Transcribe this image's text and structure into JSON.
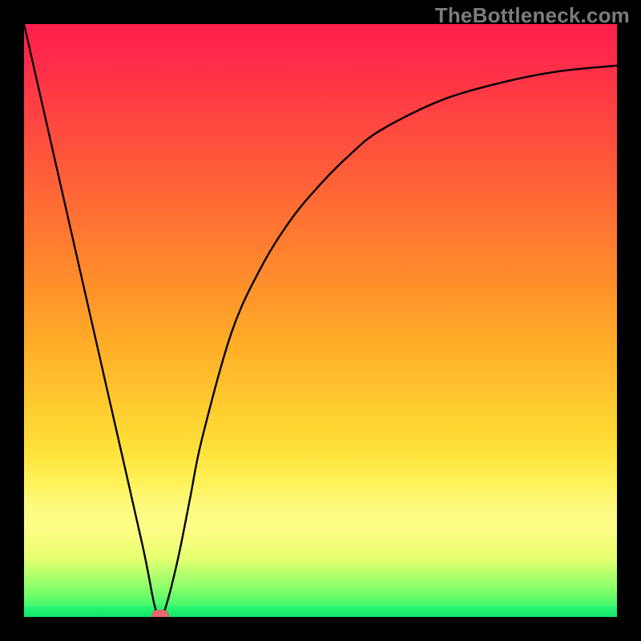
{
  "watermark": "TheBottleneck.com",
  "marker": {
    "color": "#e76b6b"
  },
  "chart_data": {
    "type": "line",
    "title": "",
    "xlabel": "",
    "ylabel": "",
    "xlim": [
      0,
      100
    ],
    "ylim": [
      0,
      100
    ],
    "grid": false,
    "background": "heat-gradient (red high → green low)",
    "series": [
      {
        "name": "bottleneck-curve",
        "x": [
          0,
          5,
          10,
          15,
          20,
          22,
          23,
          24,
          26,
          28,
          30,
          35,
          40,
          45,
          50,
          55,
          60,
          70,
          80,
          90,
          100
        ],
        "y": [
          100,
          78,
          56,
          34,
          12,
          2,
          0,
          2,
          10,
          20,
          30,
          48,
          59,
          67,
          73,
          78,
          82,
          87,
          90,
          92,
          93
        ]
      }
    ],
    "optimal_point": {
      "x": 23,
      "y": 0
    },
    "legend": null
  }
}
